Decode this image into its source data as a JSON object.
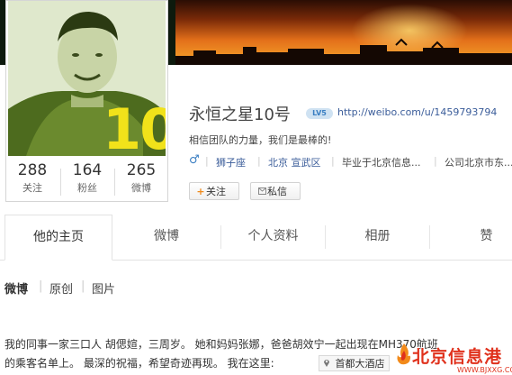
{
  "profile": {
    "name": "永恒之星10号",
    "level_badge": "LV5",
    "url": "http://weibo.com/u/1459793794",
    "description": "相信团队的力量，我们是最棒的!",
    "gender_symbol": "♂",
    "zodiac": "狮子座",
    "location": "北京 宣武区",
    "education": "毕业于北京信息...",
    "company": "公司北京市东..."
  },
  "stats": [
    {
      "value": "288",
      "label": "关注"
    },
    {
      "value": "164",
      "label": "粉丝"
    },
    {
      "value": "265",
      "label": "微博"
    }
  ],
  "jersey_number": "10",
  "buttons": {
    "follow": "关注",
    "follow_icon": "+",
    "message": "私信",
    "message_icon": "mail-icon"
  },
  "tabs": [
    "他的主页",
    "微博",
    "个人资料",
    "相册",
    "赞"
  ],
  "subnav": [
    "微博",
    "原创",
    "图片"
  ],
  "post": {
    "line1": "我的同事一家三口人 胡偲媗，三周岁。 她和妈妈张娜，爸爸胡效宁一起出现在MH370航班",
    "line2": "的乘客名单上。 最深的祝福，希望奇迹再现。 我在这里:",
    "location_tag": "首都大酒店"
  },
  "watermark": {
    "text": "北京信息港",
    "sub": "WWW.BJXXG.COM"
  },
  "colors": {
    "link": "#3b5d9a",
    "accent_orange": "#f7a92c",
    "watermark_red": "#e0311c"
  }
}
